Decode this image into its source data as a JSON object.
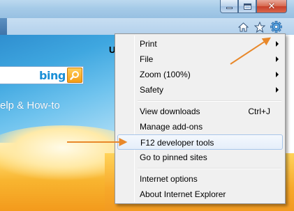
{
  "window": {
    "close_glyph": "✕"
  },
  "toolbar": {
    "icons": [
      "home-icon",
      "favorites-star-icon",
      "tools-gear-icon"
    ]
  },
  "page": {
    "header_letter": "U",
    "search": {
      "brand": "bing",
      "value": ""
    },
    "help_text": "elp & How-to"
  },
  "menu": {
    "items": [
      {
        "label": "Print",
        "submenu": true
      },
      {
        "label": "File",
        "submenu": true
      },
      {
        "label": "Zoom (100%)",
        "submenu": true
      },
      {
        "label": "Safety",
        "submenu": true
      },
      {
        "label": "View downloads",
        "shortcut": "Ctrl+J"
      },
      {
        "label": "Manage add-ons"
      },
      {
        "label": "F12 developer tools",
        "highlighted": true
      },
      {
        "label": "Go to pinned sites"
      },
      {
        "label": "Internet options"
      },
      {
        "label": "About Internet Explorer"
      }
    ]
  },
  "colors": {
    "arrow": "#e8882a",
    "menu_highlight_border": "#a8c6ea",
    "bing_blue": "#1a8fd6"
  }
}
